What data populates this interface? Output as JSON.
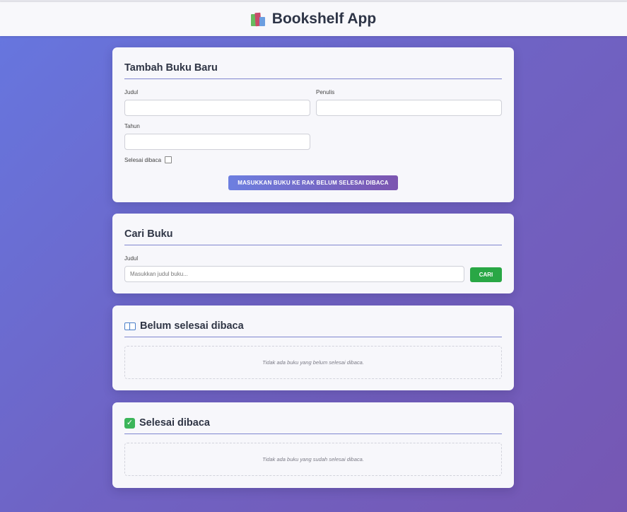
{
  "header": {
    "title": "Bookshelf App",
    "icon": "books-icon"
  },
  "add_form": {
    "title": "Tambah Buku Baru",
    "title_label": "Judul",
    "title_value": "",
    "author_label": "Penulis",
    "author_value": "",
    "year_label": "Tahun",
    "year_value": "",
    "complete_label": "Selesai dibaca",
    "complete_checked": false,
    "submit_label": "MASUKKAN BUKU KE RAK BELUM SELESAI DIBACA"
  },
  "search": {
    "title": "Cari Buku",
    "label": "Judul",
    "placeholder": "Masukkan judul buku...",
    "value": "",
    "button_label": "CARI"
  },
  "incomplete": {
    "title": "Belum selesai dibaca",
    "icon": "open-book-icon",
    "empty_text": "Tidak ada buku yang belum selesai dibaca."
  },
  "complete": {
    "title": "Selesai dibaca",
    "icon": "check-mark-icon",
    "empty_text": "Tidak ada buku yang sudah selesai dibaca."
  },
  "colors": {
    "accent": "#7f86cf",
    "search_button": "#29a745",
    "background_start": "#6677e0",
    "background_end": "#7657b3"
  }
}
